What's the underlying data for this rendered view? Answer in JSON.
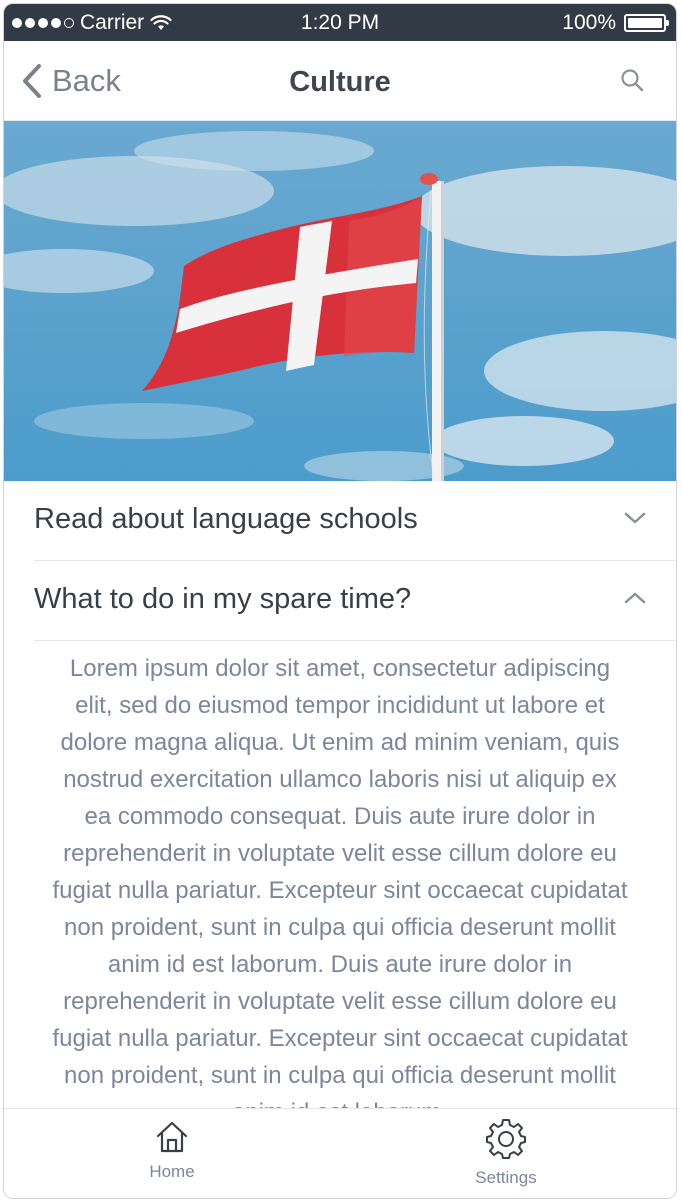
{
  "status_bar": {
    "carrier": "Carrier",
    "time": "1:20 PM",
    "battery": "100%",
    "battery_level": 1.0
  },
  "nav": {
    "back_label": "Back",
    "title": "Culture",
    "back_icon": "chevron-left-icon",
    "search_icon": "search-icon"
  },
  "hero": {
    "image": "flag-of-denmark-on-flagpole"
  },
  "accordion": {
    "items": [
      {
        "label": "Read about language schools",
        "expanded": false,
        "icon": "chevron-down-icon"
      },
      {
        "label": "What to do in my spare time?",
        "expanded": true,
        "icon": "chevron-up-icon"
      }
    ],
    "body_text": "Lorem ipsum dolor sit amet, consectetur adipiscing elit, sed do eiusmod tempor incididunt ut labore et dolore magna aliqua. Ut enim ad minim veniam, quis nostrud exercitation ullamco laboris nisi ut aliquip ex ea commodo consequat. Duis aute irure dolor in reprehenderit in voluptate velit esse cillum dolore eu fugiat nulla pariatur. Excepteur sint occaecat cupidatat non proident, sunt in culpa qui officia deserunt mollit anim id est laborum. Duis aute irure dolor in reprehenderit in voluptate velit esse cillum dolore eu fugiat nulla pariatur. Excepteur sint occaecat cupidatat non proident, sunt in culpa qui officia deserunt mollit anim id est laborum."
  },
  "tab_bar": {
    "home_label": "Home",
    "settings_label": "Settings",
    "home_icon": "home-icon",
    "settings_icon": "gear-icon"
  },
  "colors": {
    "status_bar_bg": "#323a45",
    "text_primary": "#3a3f47",
    "text_muted": "#7c869c",
    "flag_red": "#d8313b",
    "sky_blue": "#5aa3cf"
  }
}
